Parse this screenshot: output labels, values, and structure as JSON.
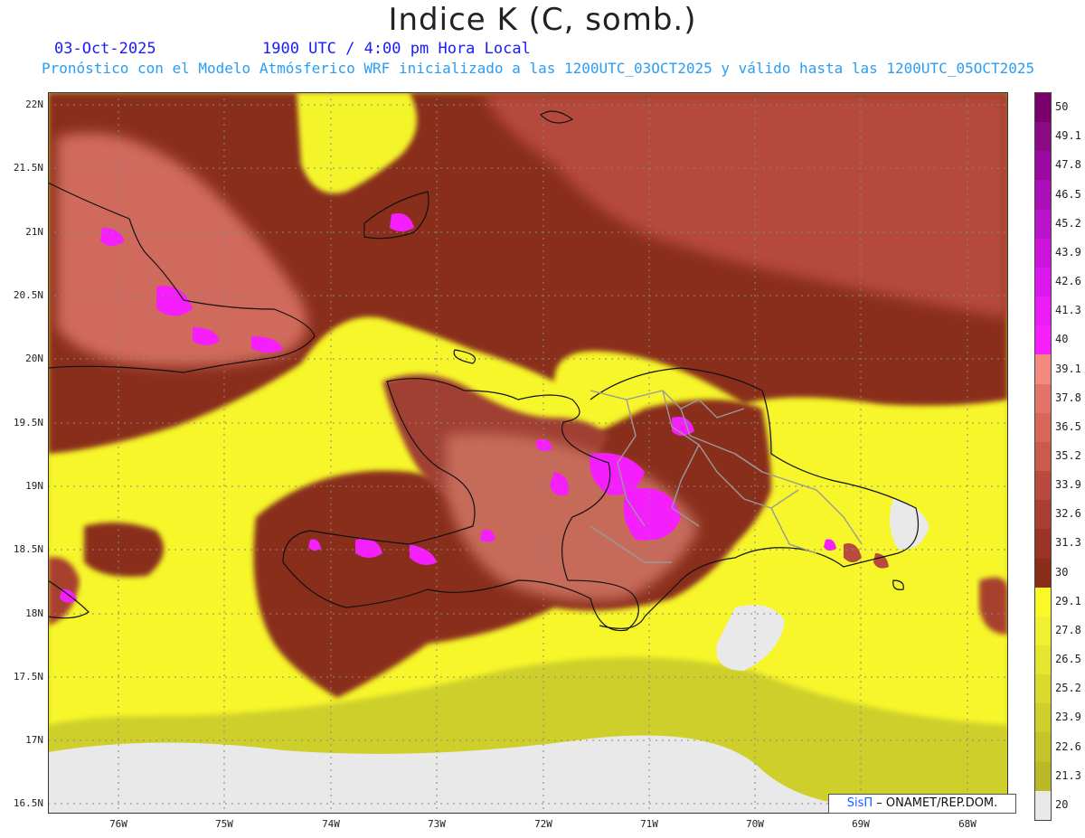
{
  "title": "Indice K (C, somb.)",
  "date": "03-Oct-2025",
  "time": "1900 UTC / 4:00 pm Hora Local",
  "subtitle": "Pronóstico con el Modelo Atmósferico WRF inicializado a las 1200UTC_03OCT2025 y válido hasta las  1200UTC_05OCT2025",
  "lat_labels": [
    "22N",
    "21.5N",
    "21N",
    "20.5N",
    "20N",
    "19.5N",
    "19N",
    "18.5N",
    "18N",
    "17.5N",
    "17N",
    "16.5N"
  ],
  "lon_labels": [
    "76W",
    "75W",
    "74W",
    "73W",
    "72W",
    "71W",
    "70W",
    "69W",
    "68W"
  ],
  "colorbar": {
    "labels": [
      "50",
      "49.1",
      "47.8",
      "46.5",
      "45.2",
      "43.9",
      "42.6",
      "41.3",
      "40",
      "39.1",
      "37.8",
      "36.5",
      "35.2",
      "33.9",
      "32.6",
      "31.3",
      "30",
      "29.1",
      "27.8",
      "26.5",
      "25.2",
      "23.9",
      "22.6",
      "21.3",
      "20"
    ],
    "colors": [
      "#7a006e",
      "#8b0a86",
      "#9a0aa0",
      "#ab10b8",
      "#bb12cc",
      "#cc14dd",
      "#dd18ee",
      "#ec1cf8",
      "#f71ffc",
      "#f28a80",
      "#e47468",
      "#d8675a",
      "#c95a4c",
      "#b84b3d",
      "#a83f31",
      "#9a3525",
      "#8a2e1a",
      "#f9f92a",
      "#f0f030",
      "#e6e630",
      "#dada2e",
      "#cece2c",
      "#c4c42a",
      "#baba28",
      "#e9e9e9"
    ]
  },
  "credit": {
    "brand": "SisΠ",
    "text": "– ONAMET/REP.DOM."
  }
}
